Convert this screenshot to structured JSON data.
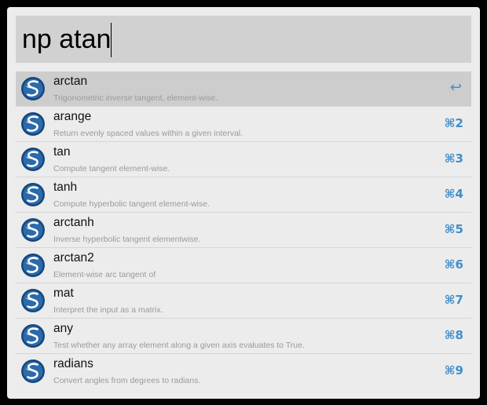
{
  "search": {
    "query": "np atan"
  },
  "results": [
    {
      "title": "arctan",
      "subtitle": "Trigonometric inverse tangent, element-wise.",
      "shortcut": "↩",
      "icon": "scipy-icon",
      "selected": true
    },
    {
      "title": "arange",
      "subtitle": "Return evenly spaced values within a given interval.",
      "shortcut": "⌘2",
      "icon": "scipy-icon",
      "selected": false
    },
    {
      "title": "tan",
      "subtitle": "Compute tangent element-wise.",
      "shortcut": "⌘3",
      "icon": "scipy-icon",
      "selected": false
    },
    {
      "title": "tanh",
      "subtitle": "Compute hyperbolic tangent element-wise.",
      "shortcut": "⌘4",
      "icon": "scipy-icon",
      "selected": false
    },
    {
      "title": "arctanh",
      "subtitle": "Inverse hyperbolic tangent elementwise.",
      "shortcut": "⌘5",
      "icon": "scipy-icon",
      "selected": false
    },
    {
      "title": "arctan2",
      "subtitle": "Element-wise arc tangent of",
      "shortcut": "⌘6",
      "icon": "scipy-icon",
      "selected": false
    },
    {
      "title": "mat",
      "subtitle": "Interpret the input as a matrix.",
      "shortcut": "⌘7",
      "icon": "scipy-icon",
      "selected": false
    },
    {
      "title": "any",
      "subtitle": "Test whether any array element along a given axis evaluates to True.",
      "shortcut": "⌘8",
      "icon": "scipy-icon",
      "selected": false
    },
    {
      "title": "radians",
      "subtitle": "Convert angles from degrees to radians.",
      "shortcut": "⌘9",
      "icon": "scipy-icon",
      "selected": false
    }
  ],
  "colors": {
    "window_bg": "#ececec",
    "search_bg": "#d1d1d1",
    "selected_bg": "#cdcdcd",
    "shortcut": "#3f8fcc",
    "icon_blue": "#1f5a96"
  }
}
